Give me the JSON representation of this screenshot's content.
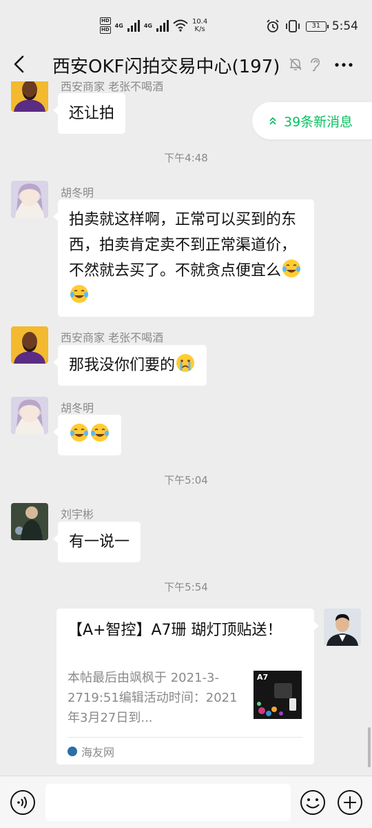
{
  "status": {
    "hd1": "HD",
    "hd2": "HD",
    "net_type1": "4G",
    "net_type2": "4G",
    "speed": "10.4",
    "speed_unit": "K/s",
    "battery": "31",
    "time": "5:54"
  },
  "header": {
    "title": "西安OKF闪拍交易中心(197)"
  },
  "new_messages": "39条新消息",
  "messages": [
    {
      "sender": "西安商家 老张不喝酒",
      "text": "还让拍"
    },
    {
      "time": "下午4:48"
    },
    {
      "sender": "胡冬明",
      "text": "拍卖就这样啊，正常可以买到的东西，拍卖肯定卖不到正常渠道价，不然就去买了。不就贪点便宜么"
    },
    {
      "sender": "西安商家 老张不喝酒",
      "text": "那我没你们要的"
    },
    {
      "sender": "胡冬明",
      "text": ""
    },
    {
      "time": "下午5:04"
    },
    {
      "sender": "刘宇彬",
      "text": "有一说一"
    },
    {
      "time": "下午5:54"
    }
  ],
  "link_card": {
    "title": "【A+智控】A7珊 瑚灯顶贴送！",
    "description": "本帖最后由飒枫于 2021-3-2719:51编辑活动时间：2021年3月27日到...",
    "thumb_label": "A7",
    "source": "海友网"
  },
  "colors": {
    "accent": "#07c160",
    "background": "#ededed",
    "bubble": "#ffffff",
    "meta_text": "#8a8a8a"
  },
  "icons": {
    "back": "chevron-left-icon",
    "mute": "bell-off-icon",
    "ear": "ear-icon",
    "more": "more-icon",
    "voice": "voice-icon",
    "emoji": "emoji-icon",
    "plus": "plus-icon"
  }
}
